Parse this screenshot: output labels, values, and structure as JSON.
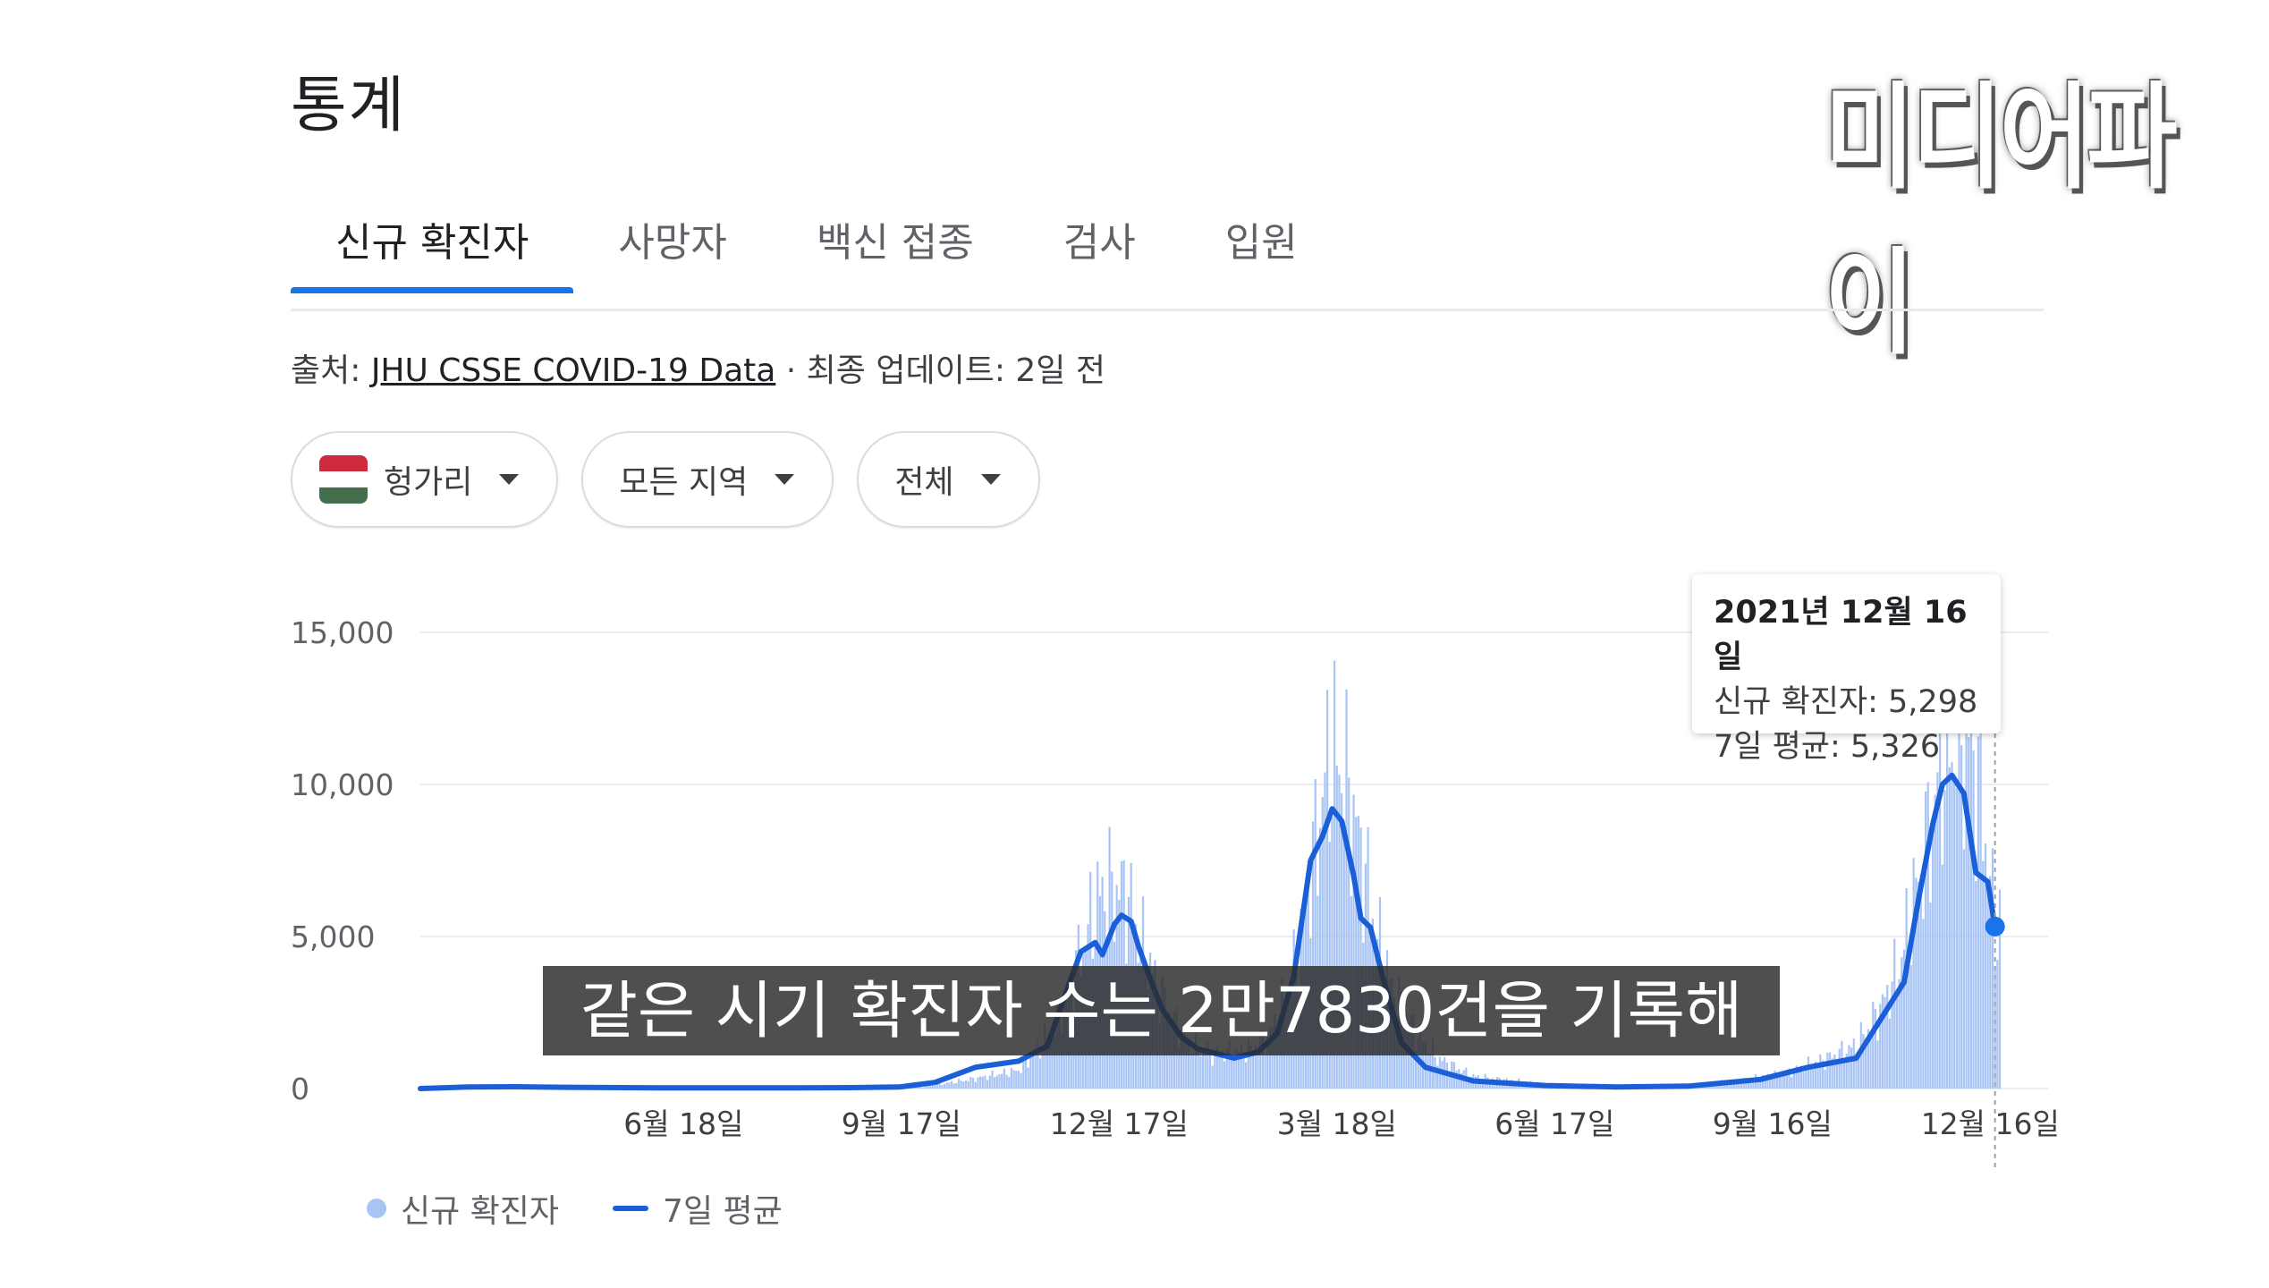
{
  "page_title": "통계",
  "watermark": "미디어파이",
  "tabs": [
    {
      "label": "신규 확진자",
      "active": true
    },
    {
      "label": "사망자",
      "active": false
    },
    {
      "label": "백신 접종",
      "active": false
    },
    {
      "label": "검사",
      "active": false
    },
    {
      "label": "입원",
      "active": false
    }
  ],
  "source": {
    "prefix": "출처: ",
    "link_text": "JHU CSSE COVID-19 Data",
    "suffix": " · 최종 업데이트: 2일 전"
  },
  "filters": {
    "country": "헝가리",
    "region": "모든 지역",
    "period": "전체"
  },
  "colors": {
    "accent": "#1a73e8",
    "bar": "#a8c4f4",
    "avg_line": "#1a5fd8",
    "flag_red": "#cd2a3e",
    "flag_white": "#ffffff",
    "flag_green": "#436f4d"
  },
  "tooltip": {
    "date": "2021년 12월 16일",
    "new_cases": "신규 확진자: 5,298",
    "avg": "7일 평균: 5,326"
  },
  "legend": {
    "series1": "신규 확진자",
    "series2": "7일 평균"
  },
  "caption": "같은 시기 확진자 수는 2만7830건을 기록해",
  "chart_data": {
    "type": "bar",
    "title": "",
    "xlabel": "",
    "ylabel": "",
    "ylim": [
      0,
      15000
    ],
    "yticks": [
      0,
      5000,
      10000,
      15000
    ],
    "ytick_labels": [
      "0",
      "5,000",
      "10,000",
      "15,000"
    ],
    "xtick_labels": [
      "6월 18일",
      "9월 17일",
      "12월 17일",
      "3월 18일",
      "6월 17일",
      "9월 16일",
      "12월 16일"
    ],
    "xticks_day": [
      110,
      201,
      292,
      383,
      474,
      565,
      656
    ],
    "day_range": [
      0,
      660
    ],
    "grid": true,
    "legend_position": "bottom-left",
    "series": [
      {
        "name": "신규 확진자",
        "kind": "bar",
        "anchors": [
          [
            0,
            0
          ],
          [
            30,
            0
          ],
          [
            60,
            20
          ],
          [
            110,
            20
          ],
          [
            150,
            20
          ],
          [
            190,
            30
          ],
          [
            210,
            60
          ],
          [
            230,
            300
          ],
          [
            250,
            600
          ],
          [
            265,
            2000
          ],
          [
            272,
            3500
          ],
          [
            278,
            5000
          ],
          [
            285,
            6500
          ],
          [
            295,
            6500
          ],
          [
            300,
            5000
          ],
          [
            310,
            3000
          ],
          [
            320,
            1500
          ],
          [
            330,
            1200
          ],
          [
            345,
            1200
          ],
          [
            355,
            1800
          ],
          [
            362,
            3000
          ],
          [
            368,
            5000
          ],
          [
            375,
            8500
          ],
          [
            380,
            11000
          ],
          [
            385,
            10500
          ],
          [
            390,
            9000
          ],
          [
            395,
            7000
          ],
          [
            400,
            5000
          ],
          [
            405,
            3500
          ],
          [
            415,
            2000
          ],
          [
            425,
            1000
          ],
          [
            440,
            400
          ],
          [
            470,
            150
          ],
          [
            500,
            80
          ],
          [
            530,
            120
          ],
          [
            550,
            250
          ],
          [
            570,
            500
          ],
          [
            585,
            900
          ],
          [
            600,
            1400
          ],
          [
            610,
            2600
          ],
          [
            618,
            4000
          ],
          [
            625,
            6500
          ],
          [
            632,
            9000
          ],
          [
            637,
            11000
          ],
          [
            645,
            11500
          ],
          [
            652,
            10000
          ],
          [
            655,
            7500
          ],
          [
            658,
            5298
          ]
        ]
      },
      {
        "name": "7일 평균",
        "kind": "line",
        "anchors": [
          [
            0,
            0
          ],
          [
            20,
            50
          ],
          [
            40,
            60
          ],
          [
            60,
            40
          ],
          [
            100,
            20
          ],
          [
            150,
            20
          ],
          [
            180,
            30
          ],
          [
            200,
            50
          ],
          [
            215,
            200
          ],
          [
            232,
            700
          ],
          [
            250,
            900
          ],
          [
            262,
            1400
          ],
          [
            270,
            3200
          ],
          [
            276,
            4500
          ],
          [
            282,
            4800
          ],
          [
            285,
            4400
          ],
          [
            290,
            5400
          ],
          [
            293,
            5700
          ],
          [
            297,
            5500
          ],
          [
            300,
            4700
          ],
          [
            305,
            3600
          ],
          [
            310,
            2600
          ],
          [
            318,
            1700
          ],
          [
            325,
            1300
          ],
          [
            340,
            1000
          ],
          [
            350,
            1200
          ],
          [
            358,
            1800
          ],
          [
            365,
            3700
          ],
          [
            372,
            7500
          ],
          [
            377,
            8300
          ],
          [
            381,
            9200
          ],
          [
            385,
            8800
          ],
          [
            390,
            7000
          ],
          [
            393,
            5600
          ],
          [
            397,
            5300
          ],
          [
            402,
            3700
          ],
          [
            410,
            1500
          ],
          [
            420,
            700
          ],
          [
            440,
            250
          ],
          [
            470,
            100
          ],
          [
            500,
            50
          ],
          [
            530,
            80
          ],
          [
            560,
            300
          ],
          [
            580,
            700
          ],
          [
            600,
            1000
          ],
          [
            612,
            2500
          ],
          [
            620,
            3500
          ],
          [
            626,
            6200
          ],
          [
            632,
            8700
          ],
          [
            636,
            10000
          ],
          [
            640,
            10300
          ],
          [
            645,
            9700
          ],
          [
            650,
            7100
          ],
          [
            655,
            6800
          ],
          [
            658,
            5326
          ]
        ]
      }
    ]
  }
}
